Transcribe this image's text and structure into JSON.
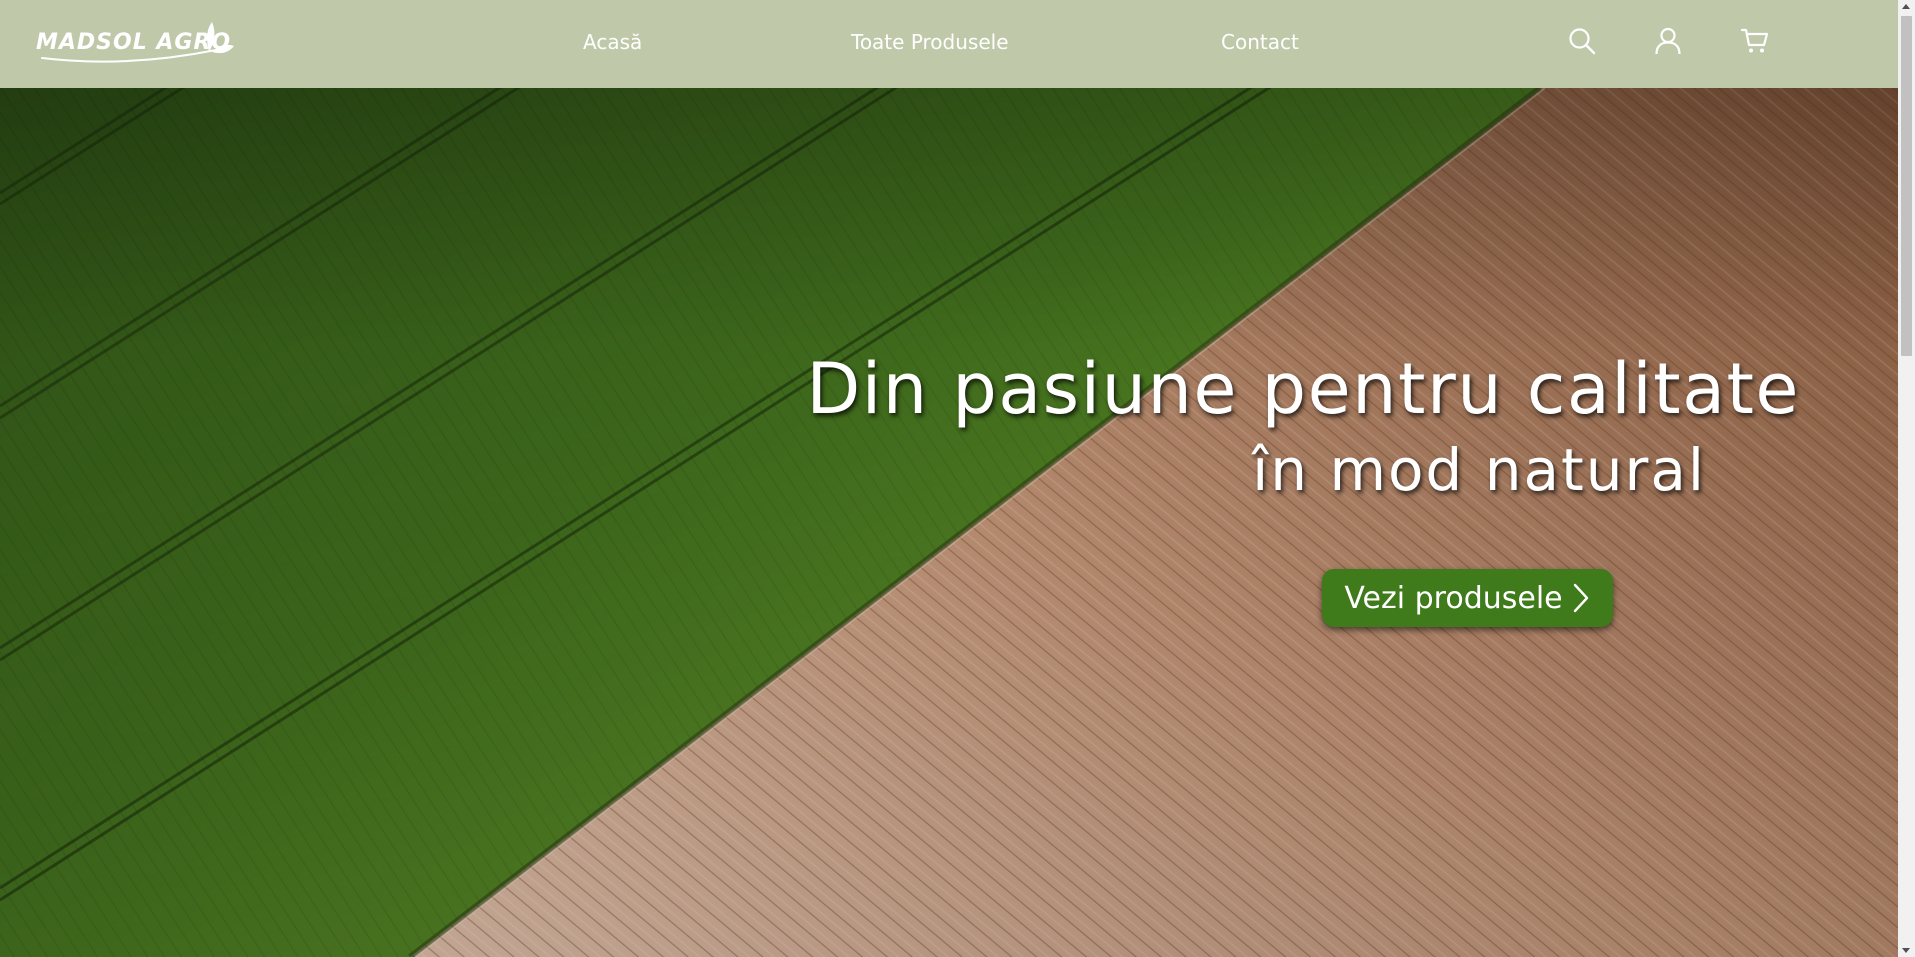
{
  "brand": {
    "logo_text": "MADSOL AGRO",
    "header_bg": "#bfc9aa",
    "accent": "#3f7a1b"
  },
  "nav": {
    "items": [
      {
        "label": "Acasă"
      },
      {
        "label": "Toate Produsele"
      },
      {
        "label": "Contact"
      }
    ]
  },
  "header_icons": [
    "search-icon",
    "user-icon",
    "cart-icon"
  ],
  "hero": {
    "title": "Din pasiune pentru calitate",
    "subtitle": "în mod natural",
    "cta_label": "Vezi produsele",
    "cta_icon": "chevron-right-icon"
  }
}
